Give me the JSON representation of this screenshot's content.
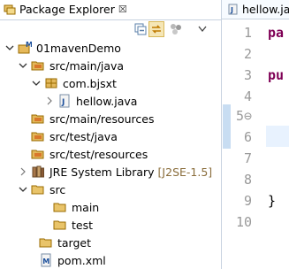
{
  "explorer": {
    "tab_label": "Package Explorer",
    "tab_close": "☒",
    "tree": [
      {
        "label": "01mavenDemo",
        "deco": "",
        "icon": "maven-project-icon",
        "twisty": "expanded"
      },
      {
        "label": "src/main/java",
        "deco": "",
        "icon": "source-folder-icon",
        "twisty": "expanded"
      },
      {
        "label": "com.bjsxt",
        "deco": "",
        "icon": "package-icon",
        "twisty": "expanded"
      },
      {
        "label": "hellow.java",
        "deco": "",
        "icon": "java-file-icon",
        "twisty": "collapsed"
      },
      {
        "label": "src/main/resources",
        "deco": "",
        "icon": "source-folder-icon",
        "twisty": ""
      },
      {
        "label": "src/test/java",
        "deco": "",
        "icon": "source-folder-icon",
        "twisty": ""
      },
      {
        "label": "src/test/resources",
        "deco": "",
        "icon": "source-folder-icon",
        "twisty": ""
      },
      {
        "label": "JRE System Library",
        "deco": "[J2SE-1.5]",
        "icon": "library-icon",
        "twisty": "collapsed"
      },
      {
        "label": "src",
        "deco": "",
        "icon": "folder-icon",
        "twisty": "expanded"
      },
      {
        "label": "main",
        "deco": "",
        "icon": "folder-icon",
        "twisty": ""
      },
      {
        "label": "test",
        "deco": "",
        "icon": "folder-icon",
        "twisty": ""
      },
      {
        "label": "target",
        "deco": "",
        "icon": "folder-icon",
        "twisty": ""
      },
      {
        "label": "pom.xml",
        "deco": "",
        "icon": "xml-file-icon",
        "twisty": ""
      }
    ]
  },
  "editor": {
    "tab_label": "hellow.java",
    "lines": [
      {
        "num": "1",
        "code": "pa"
      },
      {
        "num": "2",
        "code": ""
      },
      {
        "num": "3",
        "code": "pu"
      },
      {
        "num": "4",
        "code": ""
      },
      {
        "num": "5⊖",
        "code": ""
      },
      {
        "num": "6",
        "code": ""
      },
      {
        "num": "7",
        "code": ""
      },
      {
        "num": "8",
        "code": ""
      },
      {
        "num": "9",
        "code": "}"
      },
      {
        "num": "10",
        "code": ""
      }
    ]
  }
}
